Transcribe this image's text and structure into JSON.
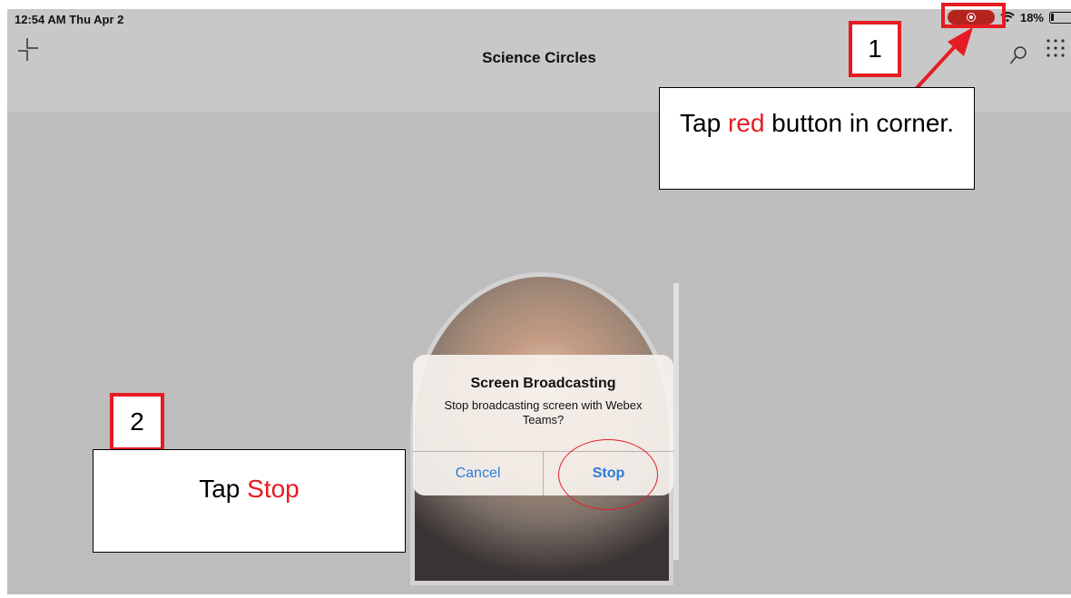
{
  "status_bar": {
    "time": "12:54 AM  Thu Apr 2",
    "battery": "18%",
    "icons": [
      "screen-recording-icon",
      "wifi-icon",
      "battery-icon"
    ]
  },
  "header": {
    "title": "Science Circles",
    "icons": [
      "minimize-icon",
      "search-icon",
      "apps-grid-icon"
    ]
  },
  "dialog": {
    "title": "Screen Broadcasting",
    "message": "Stop broadcasting screen with Webex Teams?",
    "cancel_label": "Cancel",
    "stop_label": "Stop"
  },
  "annotations": {
    "step1_number": "1",
    "step1_text_a": "Tap ",
    "step1_text_red": "red",
    "step1_text_b": " button in corner.",
    "step2_number": "2",
    "step2_text_a": "Tap ",
    "step2_text_red": "Stop"
  },
  "colors": {
    "annotation_red": "#e51c23",
    "ios_blue": "#2f7bd9",
    "recording_red": "#b5231d"
  }
}
